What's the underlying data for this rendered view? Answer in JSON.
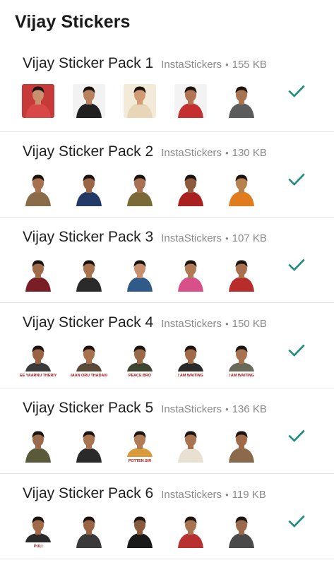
{
  "app": {
    "title": "Vijay Stickers"
  },
  "colors": {
    "accent": "#1e8c7e",
    "divider": "#e4e4e4",
    "meta_text": "#8a8a8a"
  },
  "icons": {
    "added": "check-icon"
  },
  "packs": [
    {
      "name": "Vijay Sticker Pack 1",
      "publisher": "InstaStickers",
      "separator": "•",
      "size": "155 KB",
      "added": true,
      "stickers": [
        {
          "bg": "#c73a3a",
          "skin": "#c99070",
          "shirt": "#d84848",
          "caption": ""
        },
        {
          "bg": "#f2f2f2",
          "skin": "#b8825e",
          "shirt": "#202020",
          "caption": ""
        },
        {
          "bg": "#f3ead8",
          "skin": "#d29a72",
          "shirt": "#e7d7b8",
          "caption": ""
        },
        {
          "bg": "#f3f3f3",
          "skin": "#b27452",
          "shirt": "#c43030",
          "caption": ""
        },
        {
          "bg": "#ffffff",
          "skin": "#a8734f",
          "shirt": "#5c5c5c",
          "caption": ""
        }
      ]
    },
    {
      "name": "Vijay Sticker Pack 2",
      "publisher": "InstaStickers",
      "separator": "•",
      "size": "130 KB",
      "added": true,
      "stickers": [
        {
          "bg": "#ffffff",
          "skin": "#a8704c",
          "shirt": "#8a6c4a",
          "caption": ""
        },
        {
          "bg": "#ffffff",
          "skin": "#9c6646",
          "shirt": "#233a66",
          "caption": ""
        },
        {
          "bg": "#ffffff",
          "skin": "#a8714f",
          "shirt": "#7a6a38",
          "caption": ""
        },
        {
          "bg": "#ffffff",
          "skin": "#8e5a3c",
          "shirt": "#a82020",
          "caption": ""
        },
        {
          "bg": "#ffffff",
          "skin": "#b8824e",
          "shirt": "#e07c1e",
          "caption": ""
        }
      ]
    },
    {
      "name": "Vijay Sticker Pack 3",
      "publisher": "InstaStickers",
      "separator": "•",
      "size": "107 KB",
      "added": true,
      "stickers": [
        {
          "bg": "#ffffff",
          "skin": "#a06b4a",
          "shirt": "#7a1e26",
          "caption": ""
        },
        {
          "bg": "#ffffff",
          "skin": "#a8744f",
          "shirt": "#2a2a2a",
          "caption": ""
        },
        {
          "bg": "#ffffff",
          "skin": "#c99070",
          "shirt": "#2f5a8a",
          "caption": ""
        },
        {
          "bg": "#ffffff",
          "skin": "#b07a55",
          "shirt": "#d8508a",
          "caption": ""
        },
        {
          "bg": "#ffffff",
          "skin": "#a8704c",
          "shirt": "#b82c2c",
          "caption": ""
        }
      ]
    },
    {
      "name": "Vijay Sticker Pack 4",
      "publisher": "InstaStickers",
      "separator": "•",
      "size": "150 KB",
      "added": true,
      "stickers": [
        {
          "bg": "#ffffff",
          "skin": "#9a6444",
          "shirt": "#3a3a3a",
          "caption": "NEE YAARNU THERIYA"
        },
        {
          "bg": "#ffffff",
          "skin": "#a8724e",
          "shirt": "#5a4a3a",
          "caption": "NAAN ORU THADAVA"
        },
        {
          "bg": "#ffffff",
          "skin": "#9a6a48",
          "shirt": "#3c4630",
          "caption": "PEACE BRO"
        },
        {
          "bg": "#ffffff",
          "skin": "#a06a48",
          "shirt": "#2a2a2a",
          "caption": "I AM WAITING"
        },
        {
          "bg": "#ffffff",
          "skin": "#a8744f",
          "shirt": "#6a6a5a",
          "caption": "I AM WAITING"
        }
      ]
    },
    {
      "name": "Vijay Sticker Pack 5",
      "publisher": "InstaStickers",
      "separator": "•",
      "size": "136 KB",
      "added": true,
      "stickers": [
        {
          "bg": "#ffffff",
          "skin": "#9a6a4a",
          "shirt": "#5a5a3a",
          "caption": ""
        },
        {
          "bg": "#ffffff",
          "skin": "#a8744f",
          "shirt": "#2a2a2a",
          "caption": ""
        },
        {
          "bg": "#ffffff",
          "skin": "#b07c55",
          "shirt": "#d89a3a",
          "caption": "POTTEN SIR"
        },
        {
          "bg": "#ffffff",
          "skin": "#a8744f",
          "shirt": "#e8e0d0",
          "caption": ""
        },
        {
          "bg": "#ffffff",
          "skin": "#a06a48",
          "shirt": "#8a6a4a",
          "caption": ""
        }
      ]
    },
    {
      "name": "Vijay Sticker Pack 6",
      "publisher": "InstaStickers",
      "separator": "•",
      "size": "119 KB",
      "added": true,
      "stickers": [
        {
          "bg": "#ffffff",
          "skin": "#a06a48",
          "shirt": "#2a2a2a",
          "caption": "PULI"
        },
        {
          "bg": "#ffffff",
          "skin": "#9a6444",
          "shirt": "#3a3a3a",
          "caption": ""
        },
        {
          "bg": "#ffffff",
          "skin": "#8a5a3c",
          "shirt": "#1a1a1a",
          "caption": ""
        },
        {
          "bg": "#ffffff",
          "skin": "#a8744f",
          "shirt": "#b83030",
          "caption": ""
        },
        {
          "bg": "#ffffff",
          "skin": "#9a6a4a",
          "shirt": "#4a4a4a",
          "caption": ""
        }
      ]
    }
  ]
}
